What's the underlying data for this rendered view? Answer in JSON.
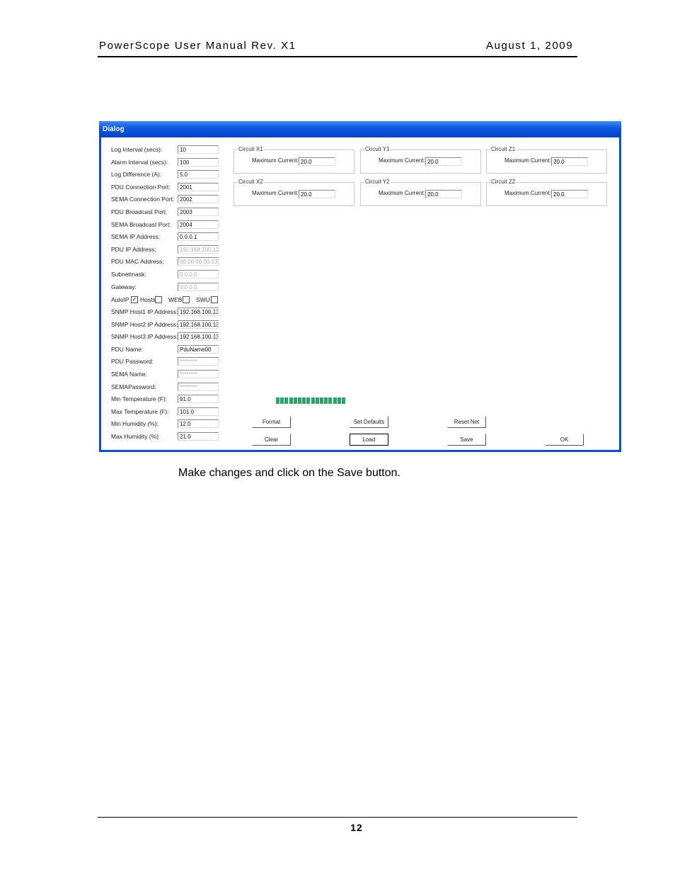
{
  "header": {
    "left": "PowerScope User Manual Rev. X1",
    "right": "August 1, 2009"
  },
  "dialog": {
    "title": "Dialog",
    "fields": [
      {
        "label": "Log Interval (secs):",
        "value": "10",
        "disabled": false
      },
      {
        "label": "Alarm Interval (secs):",
        "value": "100",
        "disabled": false
      },
      {
        "label": "Log Difference (A):",
        "value": "5.0",
        "disabled": false
      },
      {
        "label": "PDU Connection Port:",
        "value": "2001",
        "disabled": false
      },
      {
        "label": "SEMA Connection Port:",
        "value": "2002",
        "disabled": false
      },
      {
        "label": "PDU Broadcast Port:",
        "value": "2003",
        "disabled": false
      },
      {
        "label": "SEMA Broadcast Port:",
        "value": "2004",
        "disabled": false
      },
      {
        "label": "SEMA IP Address:",
        "value": "0.0.0.1",
        "disabled": false
      },
      {
        "label": "PDU IP Address:",
        "value": "192.168.100.12",
        "disabled": true
      },
      {
        "label": "PDU MAC Address:",
        "value": "00:00:00:00:13",
        "disabled": true
      },
      {
        "label": "Subnetmask:",
        "value": "0.0.0.0",
        "disabled": true
      },
      {
        "label": "Gateway:",
        "value": "0.0.0.0",
        "disabled": true
      },
      {
        "label": "SNMP Host1 IP Address:",
        "value": "192.168.100.13",
        "disabled": false
      },
      {
        "label": "SNMP Host2 IP Address:",
        "value": "192.168.100.13",
        "disabled": false
      },
      {
        "label": "SNMP Host3 IP Address:",
        "value": "192.168.100.13",
        "disabled": false
      },
      {
        "label": "PDU Name:",
        "value": "PduName00",
        "disabled": false
      },
      {
        "label": "PDU Password:",
        "value": "********",
        "disabled": true
      },
      {
        "label": "SEMA Name:",
        "value": "********",
        "disabled": true
      },
      {
        "label": "SEMAPassword:",
        "value": "********",
        "disabled": true
      },
      {
        "label": "Min Temperature (F):",
        "value": "91.0",
        "disabled": false
      },
      {
        "label": "Max Temperature (F):",
        "value": "101.0",
        "disabled": false
      },
      {
        "label": "Min Humidity (%):",
        "value": "12.0",
        "disabled": false
      },
      {
        "label": "Max Humidity (%):",
        "value": "21.0",
        "disabled": false
      }
    ],
    "checks": {
      "autoip": {
        "label": "AutoIP",
        "mark": "✓"
      },
      "hosts": {
        "label": "Hosts"
      },
      "web": {
        "label": "WEB"
      },
      "swu": {
        "label": "SWU"
      }
    },
    "circuits": [
      {
        "name": "Circuit X1",
        "label": "Maximum Current:",
        "value": "20.0"
      },
      {
        "name": "Circuit Y1",
        "label": "Maximum Current:",
        "value": "20.0"
      },
      {
        "name": "Circuit Z1",
        "label": "Maximum Current:",
        "value": "20.0"
      },
      {
        "name": "Circuit X2",
        "label": "Maximum Current:",
        "value": "20.0"
      },
      {
        "name": "Circuit Y2",
        "label": "Maximum Current:",
        "value": "20.0"
      },
      {
        "name": "Circuit Z2",
        "label": "Maximum Current:",
        "value": "20.0"
      }
    ],
    "progress": 1.0,
    "buttons": {
      "format": "Format",
      "set_defaults": "Set Defaults",
      "reset_net": "Reset Net",
      "clear": "Clear",
      "load": "Load",
      "save": "Save",
      "ok": "OK"
    },
    "colors": {
      "title_bar": "#0a56e4",
      "progress": "#2ea36a"
    }
  },
  "caption": "Make changes and click on the Save button.",
  "page_number": "12"
}
